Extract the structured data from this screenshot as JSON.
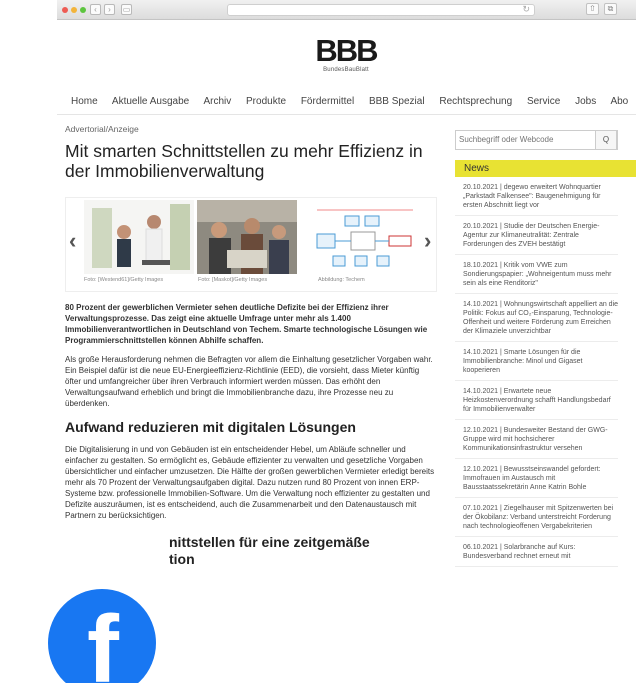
{
  "nav": [
    "Home",
    "Aktuelle Ausgabe",
    "Archiv",
    "Produkte",
    "Fördermittel",
    "BBB Spezial",
    "Rechtsprechung",
    "Service",
    "Jobs",
    "Abo"
  ],
  "logo": {
    "letters": "BBB",
    "sub": "BundesBauBlatt"
  },
  "article": {
    "category": "Advertorial/Anzeige",
    "title": "Mit smarten Schnittstellen zu mehr Effizienz in der Immobilienverwaltung",
    "captions": [
      "Foto: [Westend61]/Getty Images",
      "Foto: [Maskot]/Getty Images",
      "Abbildung: Techem"
    ],
    "lead": "80 Prozent der gewerblichen Vermieter sehen deutliche Defizite bei der Effizienz ihrer Verwaltungsprozesse. Das zeigt eine aktuelle Umfrage unter mehr als 1.400 Immobilienverantwortlichen in Deutschland von Techem. Smarte technologische Lösungen wie Programmierschnittstellen können Abhilfe schaffen.",
    "p1": "Als große Herausforderung nehmen die Befragten vor allem die Einhaltung gesetzlicher Vorgaben wahr. Ein Beispiel dafür ist die neue EU-Energieeffizienz-Richtlinie (EED), die vorsieht, dass Mieter künftig öfter und umfangreicher über ihren Verbrauch informiert werden müssen. Das erhöht den Verwaltungsaufwand erheblich und bringt die Immobilienbranche dazu, ihre Prozesse neu zu überdenken.",
    "h2": "Aufwand reduzieren mit digitalen Lösungen",
    "p2": "Die Digitalisierung in und von Gebäuden ist ein entscheidender Hebel, um Abläufe schneller und einfacher zu gestalten. So ermöglicht es, Gebäude effizienter zu verwalten und gesetzliche Vorgaben übersichtlicher und einfacher umzusetzen. Die Hälfte der großen gewerblichen Vermieter erledigt bereits mehr als 70 Prozent der Verwaltungsaufgaben digital. Dazu nutzen rund 80 Prozent von innen ERP-Systeme bzw. professionelle Immobilien-Software. Um die Verwaltung noch effizienter zu gestalten und Defizite auszuräumen, ist es entscheidend, auch die Zusammenarbeit und den Datenaustausch mit Partnern zu berücksichtigen.",
    "h2b": "nittstellen für eine zeitgemäße",
    "h2c": "tion"
  },
  "sidebar": {
    "search_placeholder": "Suchbegriff oder Webcode",
    "search_button": "Q",
    "news_title": "News",
    "news": [
      "20.10.2021 | degewo erweitert Wohnquartier „Parkstadt Falkensee\": Baugenehmigung für ersten Abschnitt liegt vor",
      "20.10.2021 | Studie der Deutschen Energie-Agentur zur Klimaneutralität: Zentrale Forderungen des ZVEH bestätigt",
      "18.10.2021 | Kritik vom VWE zum Sondierungspapier: „Wohneigentum muss mehr sein als eine Renditoriz\"",
      "14.10.2021 | Wohnungswirtschaft appelliert an die Politik: Fokus auf CO₂-Einsparung, Technologie-Offenheit und weitere Förderung zum Erreichen der Klimaziele unverzichtbar",
      "14.10.2021 | Smarte Lösungen für die Immobilienbranche: Minol und Gigaset kooperieren",
      "14.10.2021 | Erwartete neue Heizkostenverordnung schafft Handlungsbedarf für Immobilienverwalter",
      "12.10.2021 | Bundesweiter Bestand der GWG-Gruppe wird mit hochsicherer Kommunikationsinfrastruktur versehen",
      "12.10.2021 | Bewusstseinswandel gefordert: Immofrauen im Austausch mit Bausstaatssekretärin Anne Katrin Bohle",
      "07.10.2021 | Ziegelhauser mit Spitzenwerten bei der Ökobilanz: Verband unterstreicht Forderung nach technologieoffenen Vergabekriterien",
      "06.10.2021 | Solarbranche auf Kurs: Bundesverband rechnet erneut mit"
    ]
  },
  "fb_letter": "f"
}
